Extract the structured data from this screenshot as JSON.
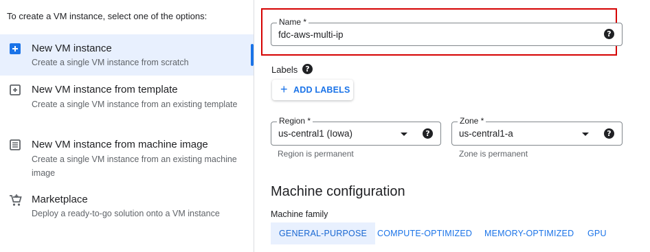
{
  "left": {
    "intro": "To create a VM instance, select one of the options:",
    "options": [
      {
        "title": "New VM instance",
        "desc": "Create a single VM instance from scratch",
        "icon": "add-box-icon"
      },
      {
        "title": "New VM instance from template",
        "desc": "Create a single VM instance from an existing template",
        "icon": "template-icon"
      },
      {
        "title": "New VM instance from machine image",
        "desc": "Create a single VM instance from an existing machine image",
        "icon": "machine-image-icon"
      },
      {
        "title": "Marketplace",
        "desc": "Deploy a ready-to-go solution onto a VM instance",
        "icon": "cart-icon"
      }
    ]
  },
  "form": {
    "name_label": "Name *",
    "name_value": "fdc-aws-multi-ip",
    "labels_label": "Labels",
    "add_labels": "ADD LABELS",
    "region_label": "Region *",
    "region_value": "us-central1 (Iowa)",
    "region_hint": "Region is permanent",
    "zone_label": "Zone *",
    "zone_value": "us-central1-a",
    "zone_hint": "Zone is permanent",
    "help_glyph": "?"
  },
  "machine": {
    "title": "Machine configuration",
    "family_label": "Machine family",
    "tabs": [
      "GENERAL-PURPOSE",
      "COMPUTE-OPTIMIZED",
      "MEMORY-OPTIMIZED",
      "GPU"
    ]
  },
  "colors": {
    "accent": "#1a73e8",
    "highlight": "#d50000",
    "selected_bg": "#e8f0fe"
  }
}
